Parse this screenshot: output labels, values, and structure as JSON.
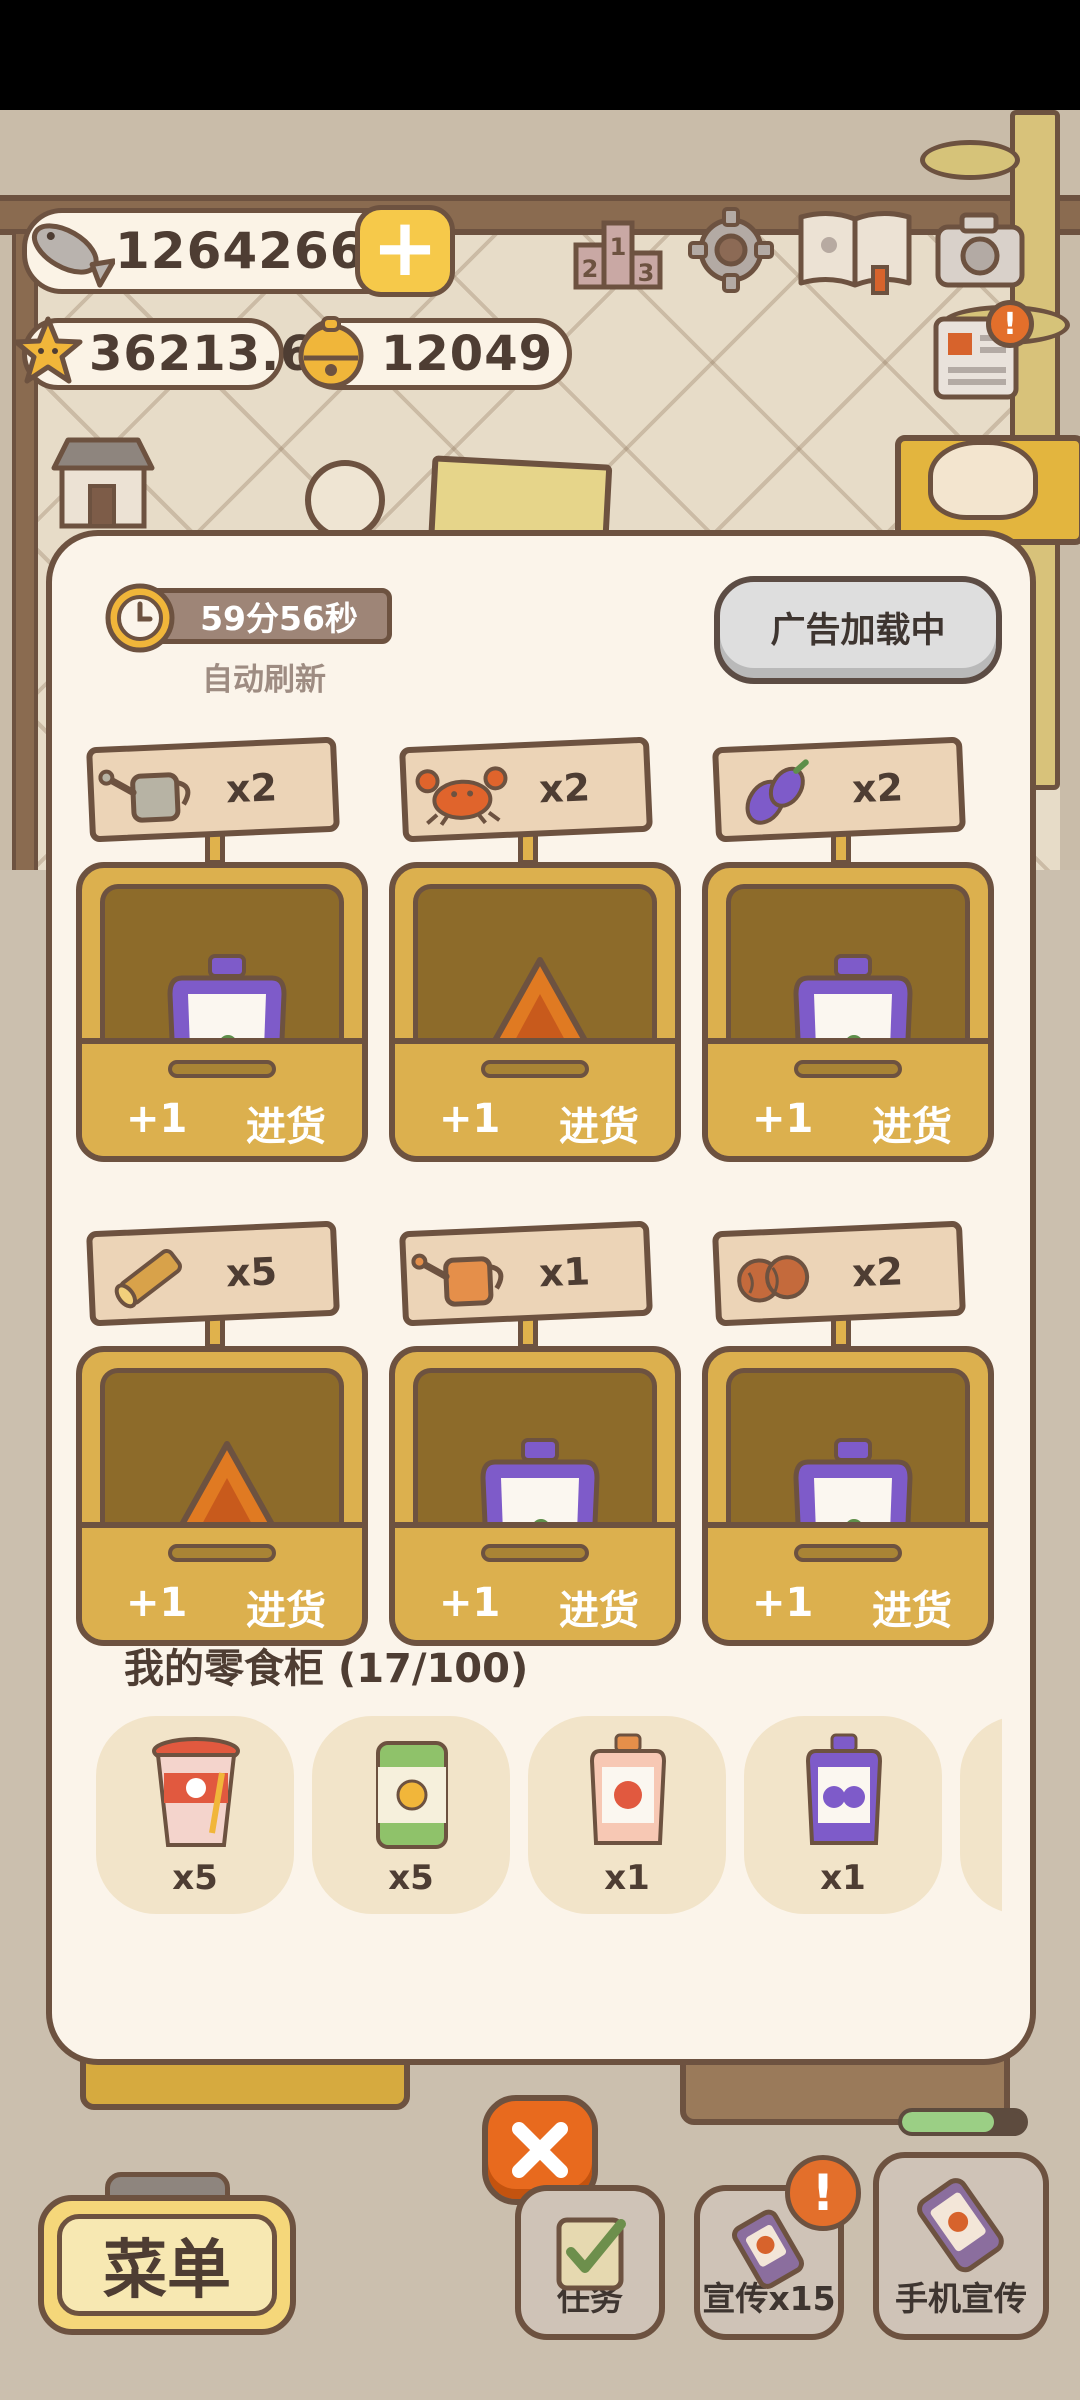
{
  "hud": {
    "fish": "1264266",
    "stars": "36213.6",
    "bells": "12049"
  },
  "panel": {
    "timer": "59分56秒",
    "auto_refresh": "自动刷新",
    "ad_button": "广告加载中",
    "slots": [
      {
        "req_icon": "watering-can-gray-icon",
        "qty": "x2",
        "product": "grape-pouch",
        "plus": "+1",
        "action": "进货"
      },
      {
        "req_icon": "crab-icon",
        "qty": "x2",
        "product": "chips-triangle",
        "plus": "+1",
        "action": "进货"
      },
      {
        "req_icon": "eggplant-icon",
        "qty": "x2",
        "product": "grape-pouch",
        "plus": "+1",
        "action": "进货"
      },
      {
        "req_icon": "wood-log-icon",
        "qty": "x5",
        "product": "chips-triangle",
        "plus": "+1",
        "action": "进货"
      },
      {
        "req_icon": "watering-can-orange-icon",
        "qty": "x1",
        "product": "grape-pouch",
        "plus": "+1",
        "action": "进货"
      },
      {
        "req_icon": "wooden-balls-icon",
        "qty": "x2",
        "product": "grape-pouch",
        "plus": "+1",
        "action": "进货"
      }
    ],
    "cabinet_title": "我的零食柜 (17/100)",
    "cabinet": [
      {
        "icon": "strawberry-cup-icon",
        "qty": "x5"
      },
      {
        "icon": "green-can-icon",
        "qty": "x5"
      },
      {
        "icon": "strawberry-pouch-icon",
        "qty": "x1"
      },
      {
        "icon": "grape-pouch-icon",
        "qty": "x1"
      }
    ]
  },
  "bottom": {
    "menu": "菜单",
    "task": "任务",
    "promo": "宣传x15",
    "phone_promo": "手机宣传"
  },
  "progress": 0.75,
  "colors": {
    "outline": "#6d5240",
    "panel_bg": "#fbf4ea",
    "crate": "#dcb04e",
    "grape": "#7e5bc9",
    "chips": "#e07a22",
    "close": "#e86a1e"
  }
}
